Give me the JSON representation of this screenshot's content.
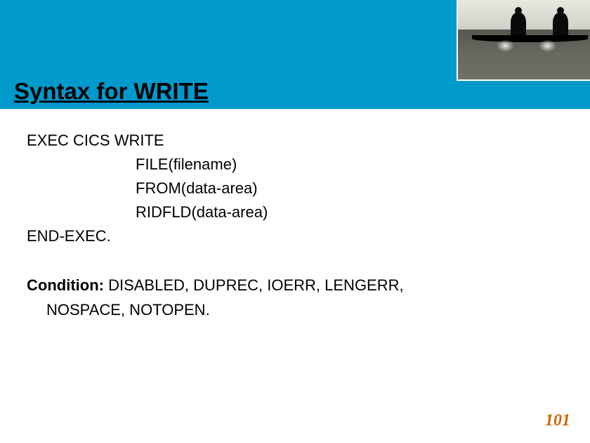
{
  "header": {
    "title": "Syntax for WRITE"
  },
  "code": {
    "line1": "EXEC CICS  WRITE",
    "line2": "FILE(filename)",
    "line3": "FROM(data-area)",
    "line4": "RIDFLD(data-area)",
    "line5": "END-EXEC."
  },
  "condition": {
    "label": "Condition: ",
    "text_line1": "DISABLED, DUPREC, IOERR, LENGERR,",
    "text_line2": "NOSPACE, NOTOPEN."
  },
  "page": {
    "number": "101"
  }
}
